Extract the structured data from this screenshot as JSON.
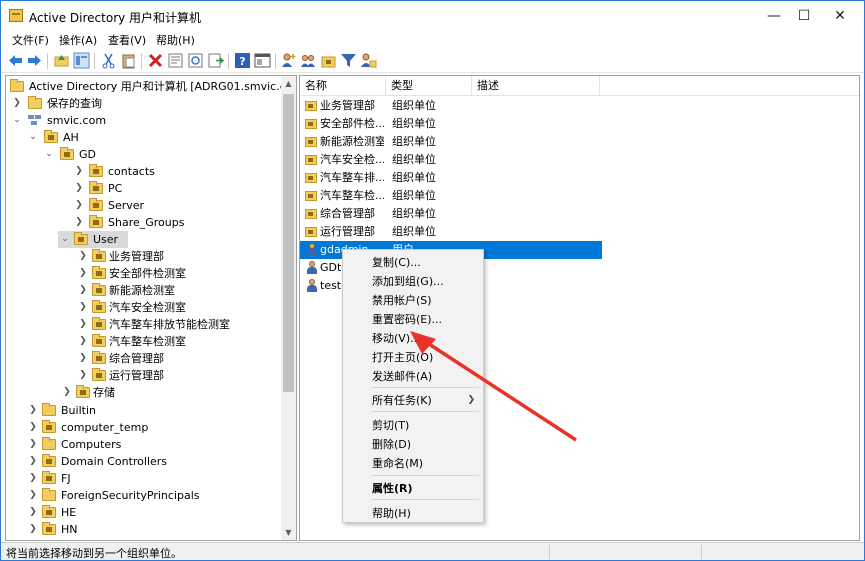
{
  "window": {
    "title": "Active Directory 用户和计算机",
    "minimize": "—",
    "maximize": "☐",
    "close": "✕"
  },
  "menu": [
    "文件(F)",
    "操作(A)",
    "查看(V)",
    "帮助(H)"
  ],
  "toolbar_icons": [
    "back-icon",
    "forward-icon",
    "up-folder-icon",
    "show-tree-icon",
    "cut-icon",
    "paste-icon",
    "delete-icon",
    "properties-icon",
    "refresh-icon",
    "export-icon",
    "help-icon",
    "console-icon",
    "add-user-icon",
    "add-group-icon",
    "add-ou-icon",
    "filter-icon",
    "delegate-icon"
  ],
  "tree": {
    "root": "Active Directory 用户和计算机 [ADRG01.smvic.com]",
    "saved_queries": "保存的查询",
    "domain": "smvic.com",
    "ah": "AH",
    "gd": "GD",
    "gd_children": [
      "contacts",
      "PC",
      "Server",
      "Share_Groups",
      "User"
    ],
    "user_children": [
      "业务管理部",
      "安全部件检测室",
      "新能源检测室",
      "汽车安全检测室",
      "汽车整车排放节能检测室",
      "汽车整车检测室",
      "综合管理部",
      "运行管理部"
    ],
    "storage": "存储",
    "domain_children": [
      "Builtin",
      "computer_temp",
      "Computers",
      "Domain Controllers",
      "FJ",
      "ForeignSecurityPrincipals",
      "HE",
      "HN"
    ]
  },
  "list": {
    "columns": [
      "名称",
      "类型",
      "描述"
    ],
    "rows": [
      {
        "name": "业务管理部",
        "type": "组织单位",
        "icon": "ou"
      },
      {
        "name": "安全部件检...",
        "type": "组织单位",
        "icon": "ou"
      },
      {
        "name": "新能源检测室",
        "type": "组织单位",
        "icon": "ou"
      },
      {
        "name": "汽车安全检...",
        "type": "组织单位",
        "icon": "ou"
      },
      {
        "name": "汽车整车排...",
        "type": "组织单位",
        "icon": "ou"
      },
      {
        "name": "汽车整车检...",
        "type": "组织单位",
        "icon": "ou"
      },
      {
        "name": "综合管理部",
        "type": "组织单位",
        "icon": "ou"
      },
      {
        "name": "运行管理部",
        "type": "组织单位",
        "icon": "ou"
      },
      {
        "name": "gdadmin",
        "type": "用户",
        "icon": "user"
      },
      {
        "name": "GDte",
        "type": "",
        "icon": "user"
      },
      {
        "name": "test0",
        "type": "",
        "icon": "user"
      }
    ]
  },
  "context_menu": {
    "items": [
      {
        "label": "复制(C)...",
        "bold": false
      },
      {
        "label": "添加到组(G)...",
        "bold": false
      },
      {
        "label": "禁用帐户(S)",
        "bold": false
      },
      {
        "label": "重置密码(E)...",
        "bold": false
      },
      {
        "label": "移动(V)...",
        "bold": false
      },
      {
        "label": "打开主页(O)",
        "bold": false
      },
      {
        "label": "发送邮件(A)",
        "bold": false
      },
      {
        "label": "所有任务(K)",
        "bold": false,
        "submenu": true
      },
      {
        "label": "剪切(T)",
        "bold": false
      },
      {
        "label": "删除(D)",
        "bold": false
      },
      {
        "label": "重命名(M)",
        "bold": false
      },
      {
        "label": "属性(R)",
        "bold": true
      },
      {
        "label": "帮助(H)",
        "bold": false
      }
    ],
    "submenu_arrow": "❯"
  },
  "status": {
    "text": "将当前选择移动到另一个组织单位。"
  },
  "colors": {
    "selection": "#0078d7",
    "arrow": "#e8322a",
    "folder": "#f3cd61"
  }
}
